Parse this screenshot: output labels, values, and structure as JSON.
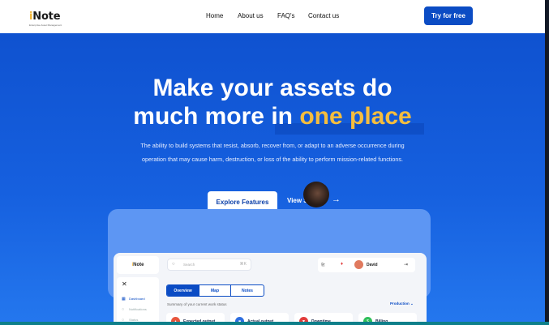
{
  "brand": {
    "logo_text": "Note",
    "logo_initial": "i",
    "tagline": "Enterprise Asset Management",
    "accent_color": "#f5bd3e",
    "primary_color": "#0b4cc4"
  },
  "nav": {
    "links": [
      "Home",
      "About us",
      "FAQ's",
      "Contact us"
    ],
    "cta_label": "Try for free"
  },
  "hero": {
    "title_line1": "Make your assets do",
    "title_line2_prefix": "much more in",
    "title_highlight": "one place",
    "description": "The ability to build systems that resist, absorb, recover from, or adapt to an adverse occurrence during operation that may cause harm, destruction, or loss of the ability to perform mission-related functions.",
    "primary_button": "Explore Features",
    "secondary_button": "View S",
    "secondary_icon": "arrow-right-icon"
  },
  "dashboard": {
    "logo_text": "Note",
    "logo_initial": "i",
    "search_placeholder": "Search",
    "search_shortcut": "⌘K",
    "user_name": "David",
    "sidebar_items": [
      "Dashboard",
      "Notifications",
      "Status"
    ],
    "tabs": [
      "Overview",
      "Map",
      "Notes"
    ],
    "active_tab": "Overview",
    "summary_text": "Summary of your current work status",
    "filter_label": "Production",
    "cards": [
      {
        "label": "Expected output",
        "color": "#e8553d"
      },
      {
        "label": "Actual output",
        "color": "#2f6fe0"
      },
      {
        "label": "Downtime",
        "color": "#e23c3c"
      },
      {
        "label": "Billing",
        "color": "#2fbf5a"
      }
    ]
  }
}
